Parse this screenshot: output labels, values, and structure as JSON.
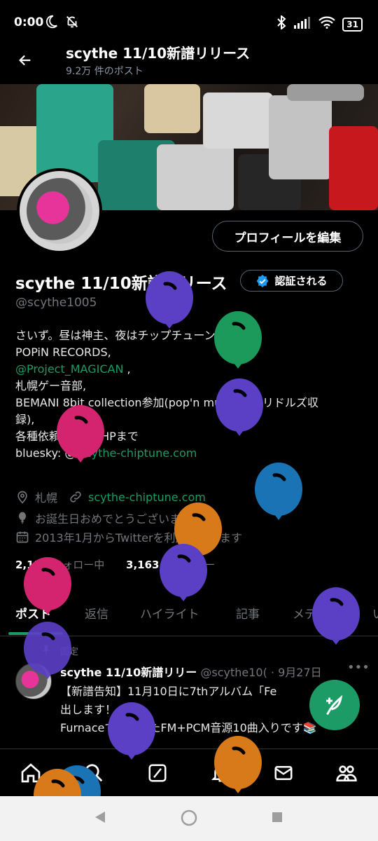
{
  "status_bar": {
    "time": "0:00",
    "battery": "31"
  },
  "header": {
    "title": "scythe 11/10新譜リリース",
    "post_count": "9.2万 件のポスト"
  },
  "profile": {
    "edit_button": "プロフィールを編集",
    "display_name": "scythe 11/10新譜リリース",
    "verified_label": "認証される",
    "handle": "@scythe1005",
    "bio_lines": [
      "さいず。昼は神主、夜はチップチューン。",
      "POPiN RECORDS,",
      "@Project_MAGICAN",
      " ,",
      "札幌ゲー音部,",
      "BEMANI 8bit collection参加(pop'n music 解明リドルズ収",
      "録),",
      "各種依頼はDMかHPまで",
      "bluesky: @ ",
      "scythe-chiptune.com"
    ],
    "location": "札幌",
    "website": "scythe-chiptune.com",
    "birthday": "お誕生日おめでとうございます。",
    "joined": "2013年1月からTwitterを利用しています",
    "following_count": "2,151",
    "following_label": "フォロー中",
    "followers_count": "3,163",
    "followers_label": "フォロワー"
  },
  "tabs": [
    "ポスト",
    "返信",
    "ハイライト",
    "記事",
    "メディア",
    "い"
  ],
  "pinned_post": {
    "pinned_label": "固定",
    "name": "scythe 11/10新譜リリー",
    "handle_date": "@scythe10( · 9月27日",
    "more": "•••",
    "body_line1": "【新譜告知】11月10日に7thアルバム「Fe",
    "body_line2": "出します！",
    "body_line3": "Furnaceで制作したFM+PCM音源10曲入りです📚"
  },
  "colors": {
    "accent": "#1d9b66",
    "background": "#000000",
    "verified": "#1d9bf0",
    "balloon_colors": [
      "#5b3fc4",
      "#1c9a5b",
      "#d4246f",
      "#1a73b5",
      "#d87a1a"
    ]
  }
}
